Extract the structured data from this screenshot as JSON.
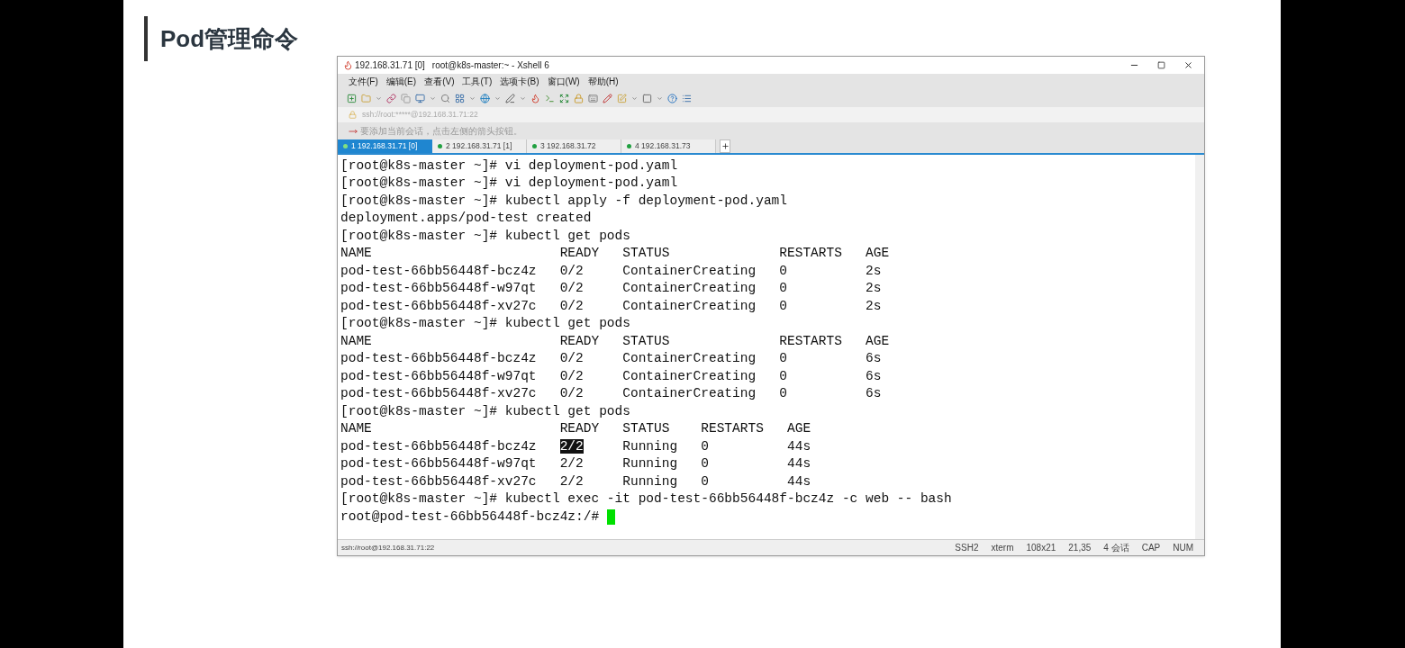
{
  "slide": {
    "heading": "Pod管理命令"
  },
  "window": {
    "session": "192.168.31.71 [0]",
    "title": "root@k8s-master:~ - Xshell 6"
  },
  "menu": [
    "文件(F)",
    "编辑(E)",
    "查看(V)",
    "工具(T)",
    "选项卡(B)",
    "窗口(W)",
    "帮助(H)"
  ],
  "address": "ssh://root:*****@192.168.31.71:22",
  "hint": "要添加当前会话，点击左侧的箭头按钮。",
  "tabs": [
    {
      "label": "1 192.168.31.71 [0]",
      "selected": true
    },
    {
      "label": "2 192.168.31.71 [1]",
      "selected": false
    },
    {
      "label": "3 192.168.31.72",
      "selected": false
    },
    {
      "label": "4 192.168.31.73",
      "selected": false
    }
  ],
  "terminal": [
    {
      "text": "[root@k8s-master ~]# vi deployment-pod.yaml"
    },
    {
      "text": "[root@k8s-master ~]# vi deployment-pod.yaml"
    },
    {
      "text": "[root@k8s-master ~]# kubectl apply -f deployment-pod.yaml"
    },
    {
      "text": "deployment.apps/pod-test created"
    },
    {
      "text": "[root@k8s-master ~]# kubectl get pods"
    },
    {
      "text": "NAME                        READY   STATUS              RESTARTS   AGE"
    },
    {
      "text": "pod-test-66bb56448f-bcz4z   0/2     ContainerCreating   0          2s"
    },
    {
      "text": "pod-test-66bb56448f-w97qt   0/2     ContainerCreating   0          2s"
    },
    {
      "text": "pod-test-66bb56448f-xv27c   0/2     ContainerCreating   0          2s"
    },
    {
      "text": "[root@k8s-master ~]# kubectl get pods"
    },
    {
      "text": "NAME                        READY   STATUS              RESTARTS   AGE"
    },
    {
      "text": "pod-test-66bb56448f-bcz4z   0/2     ContainerCreating   0          6s"
    },
    {
      "text": "pod-test-66bb56448f-w97qt   0/2     ContainerCreating   0          6s"
    },
    {
      "text": "pod-test-66bb56448f-xv27c   0/2     ContainerCreating   0          6s"
    },
    {
      "text": "[root@k8s-master ~]# kubectl get pods"
    },
    {
      "text": "NAME                        READY   STATUS    RESTARTS   AGE"
    },
    {
      "segments": [
        {
          "text": "pod-test-66bb56448f-bcz4z   ",
          "highlighted": false
        },
        {
          "text": "2/2",
          "highlighted": true
        },
        {
          "text": "     Running   0          44s",
          "highlighted": false
        }
      ]
    },
    {
      "text": "pod-test-66bb56448f-w97qt   2/2     Running   0          44s"
    },
    {
      "text": "pod-test-66bb56448f-xv27c   2/2     Running   0          44s"
    },
    {
      "text": "[root@k8s-master ~]# kubectl exec -it pod-test-66bb56448f-bcz4z -c web -- bash"
    },
    {
      "text": "root@pod-test-66bb56448f-bcz4z:/# ",
      "cursor": true
    }
  ],
  "status_bar": {
    "connection": "ssh://root@192.168.31.71:22",
    "items": [
      "SSH2",
      "xterm",
      "108x21",
      "21,35",
      "4 会话",
      "CAP",
      "NUM"
    ]
  }
}
